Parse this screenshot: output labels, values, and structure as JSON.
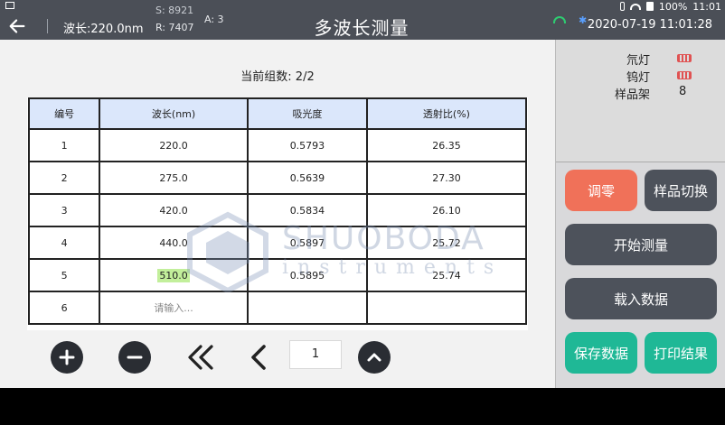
{
  "status_bar": {
    "time": "11:01",
    "battery": "100%"
  },
  "header": {
    "wavelength": "波长:220.0nm",
    "s_value": "S: 8921",
    "r_value": "R: 7407",
    "a_value": "A: 3",
    "title": "多波长测量",
    "datetime": "2020-07-19 11:01:28"
  },
  "main": {
    "group_count": "当前组数: 2/2",
    "table": {
      "headers": [
        "编号",
        "波长(nm)",
        "吸光度",
        "透射比(%)"
      ],
      "rows": [
        {
          "no": "1",
          "wavelength": "220.0",
          "absorbance": "0.5793",
          "transmittance": "26.35"
        },
        {
          "no": "2",
          "wavelength": "275.0",
          "absorbance": "0.5639",
          "transmittance": "27.30"
        },
        {
          "no": "3",
          "wavelength": "420.0",
          "absorbance": "0.5834",
          "transmittance": "26.10"
        },
        {
          "no": "4",
          "wavelength": "440.0",
          "absorbance": "0.5897",
          "transmittance": "25.72"
        },
        {
          "no": "5",
          "wavelength": "510.0",
          "absorbance": "0.5895",
          "transmittance": "25.74"
        },
        {
          "no": "6",
          "wavelength_placeholder": "请输入..."
        }
      ],
      "highlight_color": "#c2ef9b",
      "header_color": "#dbe7fb"
    },
    "watermark": {
      "brand": "SHUOBODA",
      "sub": "instruments"
    },
    "page_value": "1"
  },
  "right_panel": {
    "status": {
      "deuterium_lamp": "氘灯",
      "tungsten_lamp": "钨灯",
      "sample_holder": "样品架",
      "sample_holder_value": "8"
    },
    "buttons": {
      "zero": "调零",
      "switch_sample": "样品切换",
      "start_measure": "开始测量",
      "load_data": "载入数据",
      "save_data": "保存数据",
      "print_result": "打印结果"
    },
    "colors": {
      "zero": "#f07159",
      "dark": "#4d525b",
      "green": "#1fb896"
    }
  }
}
